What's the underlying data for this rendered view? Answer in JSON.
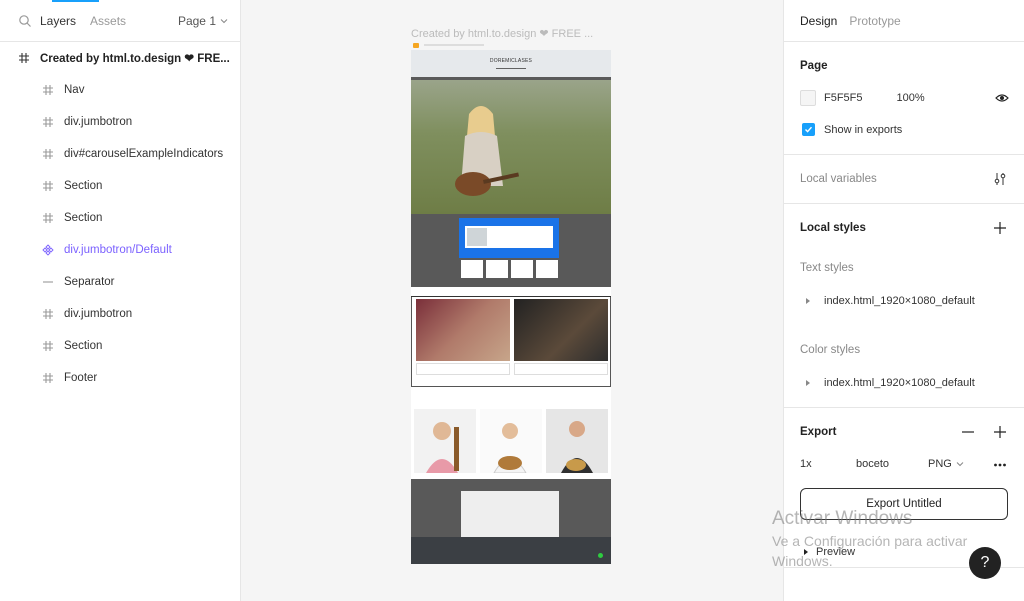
{
  "left_panel": {
    "tabs": [
      "Layers",
      "Assets"
    ],
    "page_selector": "Page 1",
    "root_layer": "Created by html.to.design ❤ FRE...",
    "layers": [
      {
        "label": "Nav",
        "kind": "frame"
      },
      {
        "label": "div.jumbotron",
        "kind": "frame"
      },
      {
        "label": "div#carouselExampleIndicators",
        "kind": "frame"
      },
      {
        "label": "Section",
        "kind": "frame"
      },
      {
        "label": "Section",
        "kind": "frame"
      },
      {
        "label": "div.jumbotron/Default",
        "kind": "component"
      },
      {
        "label": "Separator",
        "kind": "line"
      },
      {
        "label": "div.jumbotron",
        "kind": "frame"
      },
      {
        "label": "Section",
        "kind": "frame"
      },
      {
        "label": "Footer",
        "kind": "frame"
      }
    ]
  },
  "canvas": {
    "frame_title": "Created by html.to.design ❤ FREE ...",
    "site_brand": "DOREMICLASES",
    "background": "#F5F5F5"
  },
  "right_panel": {
    "tabs": [
      "Design",
      "Prototype"
    ],
    "page": {
      "title": "Page",
      "color": "F5F5F5",
      "opacity": "100%",
      "show_in_exports": "Show in exports"
    },
    "local_variables": "Local variables",
    "local_styles": {
      "title": "Local styles",
      "text_styles_label": "Text styles",
      "text_style_item": "index.html_1920×1080_default",
      "color_styles_label": "Color styles",
      "color_style_item": "index.html_1920×1080_default"
    },
    "export": {
      "title": "Export",
      "scale": "1x",
      "suffix": "boceto",
      "format": "PNG",
      "button": "Export Untitled",
      "preview": "Preview"
    },
    "watermark": {
      "line1": "Activar Windows",
      "line2": "Ve a Configuración para activar",
      "line3": "Windows."
    },
    "help": "?"
  }
}
